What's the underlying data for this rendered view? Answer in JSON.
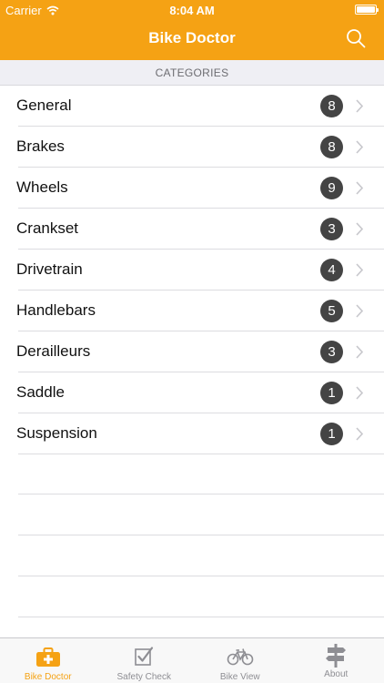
{
  "status_bar": {
    "carrier": "Carrier",
    "time": "8:04 AM"
  },
  "nav": {
    "title": "Bike Doctor",
    "search_icon": "search-icon"
  },
  "section": {
    "title": "CATEGORIES"
  },
  "categories": [
    {
      "label": "General",
      "count": "8"
    },
    {
      "label": "Brakes",
      "count": "8"
    },
    {
      "label": "Wheels",
      "count": "9"
    },
    {
      "label": "Crankset",
      "count": "3"
    },
    {
      "label": "Drivetrain",
      "count": "4"
    },
    {
      "label": "Handlebars",
      "count": "5"
    },
    {
      "label": "Derailleurs",
      "count": "3"
    },
    {
      "label": "Saddle",
      "count": "1"
    },
    {
      "label": "Suspension",
      "count": "1"
    }
  ],
  "tabs": [
    {
      "label": "Bike Doctor",
      "icon": "first-aid-kit-icon",
      "active": true
    },
    {
      "label": "Safety Check",
      "icon": "checkbox-icon",
      "active": false
    },
    {
      "label": "Bike View",
      "icon": "bicycle-icon",
      "active": false
    },
    {
      "label": "About",
      "icon": "signpost-icon",
      "active": false
    }
  ],
  "colors": {
    "accent": "#f5a214",
    "badge": "#444444",
    "tab_inactive": "#8e8e93"
  }
}
